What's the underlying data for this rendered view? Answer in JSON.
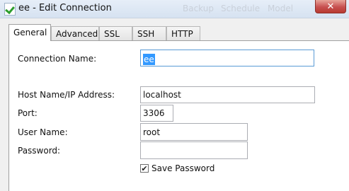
{
  "window": {
    "title": "ee - Edit Connection",
    "background_menu": [
      "Backup",
      "Schedule",
      "Model"
    ],
    "close_glyph": "✕"
  },
  "tabs": [
    {
      "label": "General",
      "active": true
    },
    {
      "label": "Advanced",
      "active": false
    },
    {
      "label": "SSL",
      "active": false
    },
    {
      "label": "SSH",
      "active": false
    },
    {
      "label": "HTTP",
      "active": false
    }
  ],
  "form": {
    "connection_name": {
      "label": "Connection Name:",
      "value": "ee"
    },
    "host": {
      "label": "Host Name/IP Address:",
      "value": "localhost"
    },
    "port": {
      "label": "Port:",
      "value": "3306"
    },
    "user": {
      "label": "User Name:",
      "value": "root"
    },
    "password": {
      "label": "Password:",
      "value": ""
    },
    "save_password": {
      "label": "Save Password",
      "checked": true
    }
  },
  "colors": {
    "selection": "#3399ff",
    "close_button": "#c75050",
    "focus_border": "#5a9bd5"
  }
}
